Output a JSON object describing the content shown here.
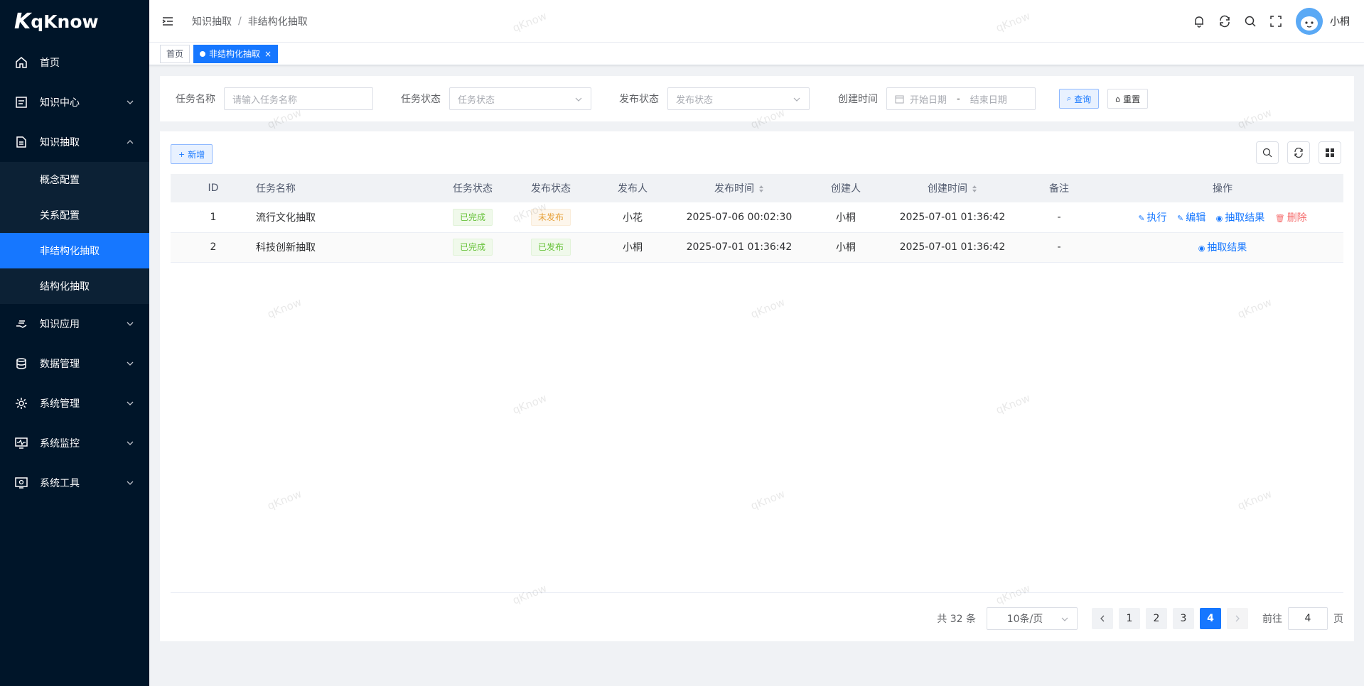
{
  "app": {
    "logo_mark": "K",
    "logo_text": "qKnow",
    "watermark": "qKnow"
  },
  "sidebar": {
    "items": [
      {
        "label": "首页",
        "icon": "home-icon"
      },
      {
        "label": "知识中心",
        "icon": "document-icon"
      },
      {
        "label": "知识抽取",
        "icon": "file-text-icon",
        "expanded": true,
        "children": [
          {
            "label": "概念配置"
          },
          {
            "label": "关系配置"
          },
          {
            "label": "非结构化抽取",
            "active": true
          },
          {
            "label": "结构化抽取"
          }
        ]
      },
      {
        "label": "知识应用",
        "icon": "hand-icon"
      },
      {
        "label": "数据管理",
        "icon": "database-icon"
      },
      {
        "label": "系统管理",
        "icon": "gear-icon"
      },
      {
        "label": "系统监控",
        "icon": "monitor-icon"
      },
      {
        "label": "系统工具",
        "icon": "tool-icon"
      }
    ]
  },
  "header": {
    "breadcrumb": [
      "知识抽取",
      "非结构化抽取"
    ],
    "separator": "/",
    "username": "小桐"
  },
  "tags": [
    {
      "label": "首页"
    },
    {
      "label": "非结构化抽取",
      "active": true,
      "close": "×"
    }
  ],
  "search": {
    "task_name_label": "任务名称",
    "task_name_placeholder": "请输入任务名称",
    "task_status_label": "任务状态",
    "task_status_placeholder": "任务状态",
    "publish_status_label": "发布状态",
    "publish_status_placeholder": "发布状态",
    "created_time_label": "创建时间",
    "start_placeholder": "开始日期",
    "range_sep": "-",
    "end_placeholder": "结束日期",
    "query_label": "查询",
    "reset_label": "重置"
  },
  "toolbar": {
    "add_label": "新增"
  },
  "table": {
    "columns": [
      "ID",
      "任务名称",
      "任务状态",
      "发布状态",
      "发布人",
      "发布时间",
      "创建人",
      "创建时间",
      "备注",
      "操作"
    ],
    "rows": [
      {
        "id": "1",
        "name": "流行文化抽取",
        "task_status": "已完成",
        "publish_status": "未发布",
        "publisher": "小花",
        "publish_time": "2025-07-06 00:02:30",
        "creator": "小桐",
        "created_time": "2025-07-01 01:36:42",
        "remark": "-"
      },
      {
        "id": "2",
        "name": "科技创新抽取",
        "task_status": "已完成",
        "publish_status": "已发布",
        "publisher": "小桐",
        "publish_time": "2025-07-01 01:36:42",
        "creator": "小桐",
        "created_time": "2025-07-01 01:36:42",
        "remark": "-"
      }
    ],
    "actions": {
      "execute": "执行",
      "edit": "编辑",
      "result": "抽取结果",
      "delete": "删除"
    }
  },
  "pagination": {
    "total": "共 32 条",
    "page_size": "10条/页",
    "pages": [
      "1",
      "2",
      "3",
      "4"
    ],
    "current": "4",
    "goto_label": "前往",
    "goto_value": "4",
    "page_suffix": "页"
  },
  "colors": {
    "primary": "#1677ff",
    "sidebar_bg": "#001529",
    "success": "#67c23a",
    "warning": "#e6a23c",
    "danger": "#f56c6c"
  }
}
